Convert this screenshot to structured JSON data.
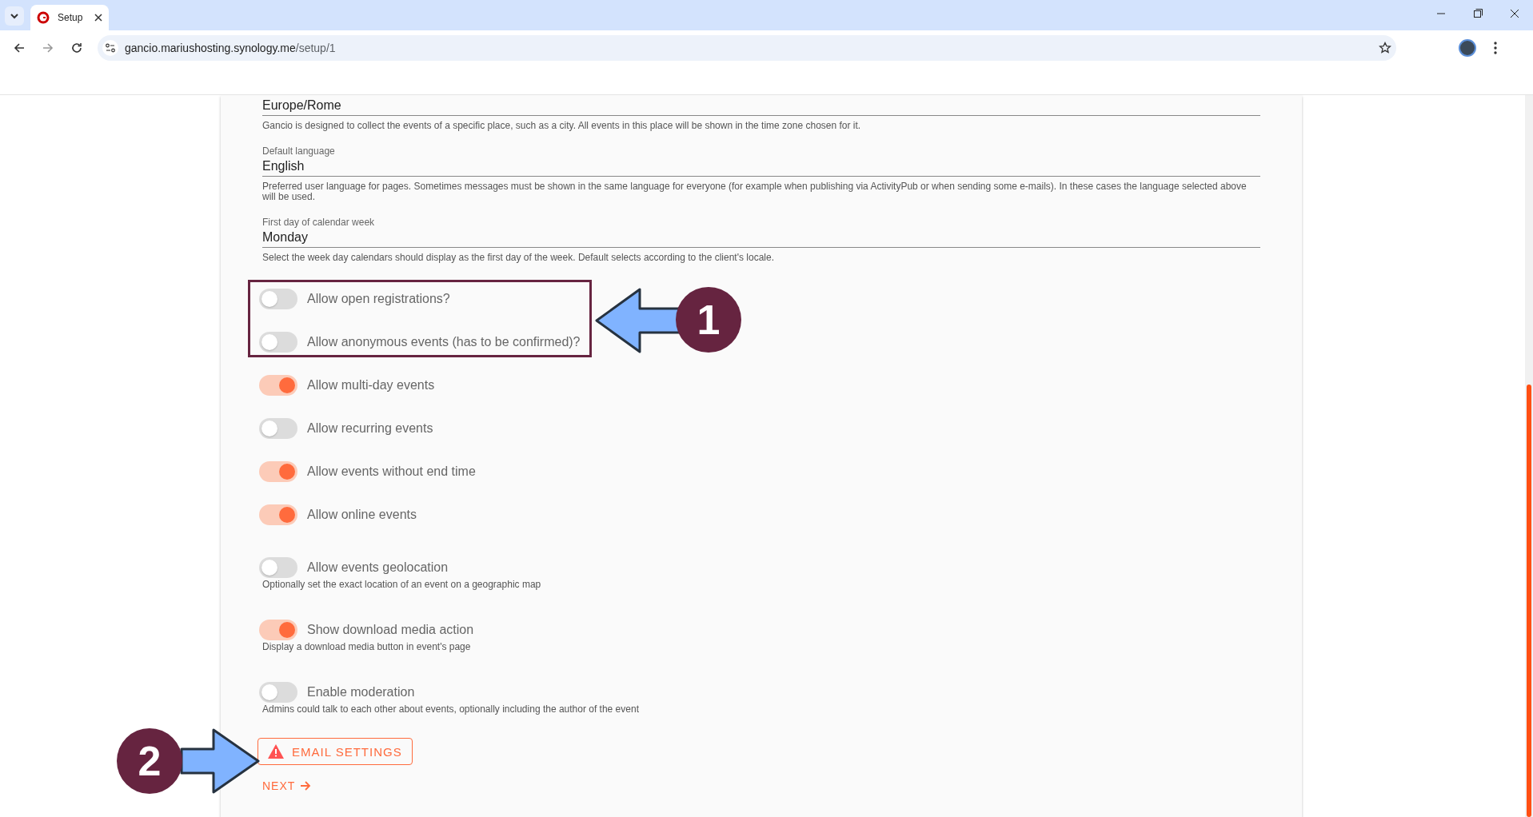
{
  "browser": {
    "tab_title": "Setup",
    "url_host": "gancio.mariushosting.synology.me",
    "url_path": "/setup/1"
  },
  "fields": [
    {
      "value": "Europe/Rome",
      "hint": "Gancio is designed to collect the events of a specific place, such as a city. All events in this place will be shown in the time zone chosen for it."
    },
    {
      "label": "Default language",
      "value": "English",
      "hint": "Preferred user language for pages. Sometimes messages must be shown in the same language for everyone (for example when publishing via ActivityPub or when sending some e-mails). In these cases the language selected above will be used."
    },
    {
      "label": "First day of calendar week",
      "value": "Monday",
      "hint": "Select the week day calendars should display as the first day of the week. Default selects according to the client's locale."
    }
  ],
  "toggles": [
    {
      "label": "Allow open registrations?",
      "on": false
    },
    {
      "label": "Allow anonymous events (has to be confirmed)?",
      "on": false
    },
    {
      "label": "Allow multi-day events",
      "on": true
    },
    {
      "label": "Allow recurring events",
      "on": false
    },
    {
      "label": "Allow events without end time",
      "on": true
    },
    {
      "label": "Allow online events",
      "on": true
    },
    {
      "label": "Allow events geolocation",
      "on": false,
      "hint": "Optionally set the exact location of an event on a geographic map"
    },
    {
      "label": "Show download media action",
      "on": true,
      "hint": "Display a download media button in event's page"
    },
    {
      "label": "Enable moderation",
      "on": false,
      "hint": "Admins could talk to each other about events, optionally including the author of the event"
    }
  ],
  "email_button": "EMAIL SETTINGS",
  "next_link": "NEXT",
  "annotations": [
    {
      "number": "1"
    },
    {
      "number": "2"
    }
  ]
}
